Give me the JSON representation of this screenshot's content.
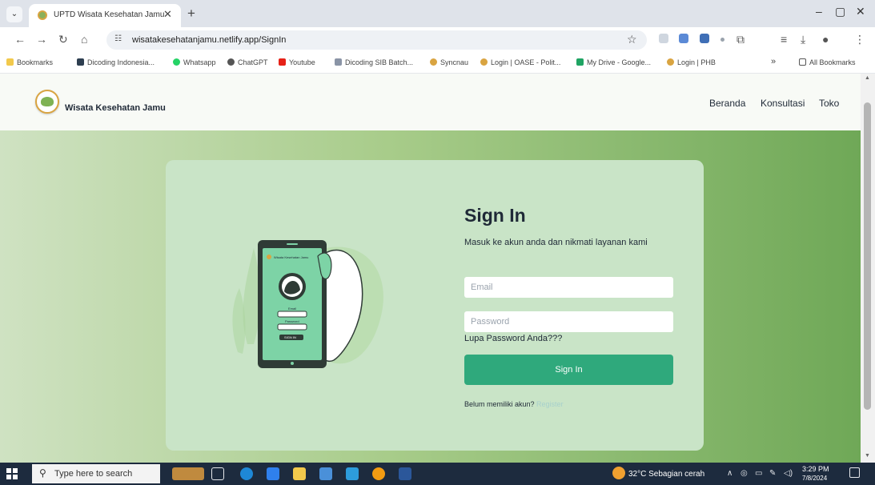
{
  "browser": {
    "tab_title": "UPTD Wisata Kesehatan Jamu",
    "url": "wisatakesehatanjamu.netlify.app/SignIn",
    "bookmarks": [
      "Bookmarks",
      "Dicoding Indonesia...",
      "Whatsapp",
      "ChatGPT",
      "Youtube",
      "Dicoding SIB Batch...",
      "Syncnau",
      "Login | OASE - Polit...",
      "My Drive - Google...",
      "Login | PHB"
    ],
    "bookmarks_overflow": "»",
    "all_bookmarks": "All Bookmarks",
    "window_controls": {
      "minimize": "–",
      "maximize": "▢",
      "close": "✕"
    }
  },
  "site": {
    "brand": "Wisata Kesehatan Jamu",
    "nav": [
      "Beranda",
      "Konsultasi",
      "Toko"
    ]
  },
  "signin": {
    "title": "Sign In",
    "subtitle": "Masuk ke akun anda dan nikmati layanan kami",
    "email_placeholder": "Email",
    "password_placeholder": "Password",
    "forgot": "Lupa Password Anda???",
    "button": "Sign In",
    "register_prompt": "Belum memiliki akun?",
    "register_link": "Register"
  },
  "illustration": {
    "phone_header": "Wisata Kesehatan Jamu",
    "email_label": "Email",
    "password_label": "Password",
    "button": "SIGN IN"
  },
  "taskbar": {
    "search_placeholder": "Type here to search",
    "weather": "32°C  Sebagian cerah",
    "time": "3:29 PM",
    "date": "7/8/2024"
  },
  "colors": {
    "primary_button": "#2fa97c",
    "card": "#c9e4c7",
    "background_gradient_end": "#6fa857",
    "register_link": "#a7d0cc"
  }
}
